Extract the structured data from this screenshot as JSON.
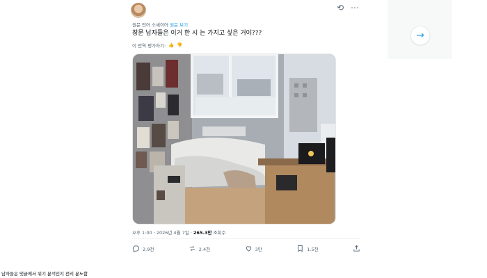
{
  "post": {
    "translated_prefix": "원문 언어 소세이어",
    "translated_link": "원문 보기",
    "text": "창문 남자들은 이거 한 시 는 가지고 싶은 거야???",
    "rate_label": "이 번역 평가하기:",
    "meta_time": "오후 1:00 · 2026년 4월 7일 · ",
    "meta_views_count": "265.3만",
    "meta_views_label": " 조회수",
    "actions": {
      "reply": "2.9천",
      "repost": "2.4천",
      "like": "3만",
      "bookmark": "1.5천"
    }
  },
  "caption": "남자들은 댓글에서 위기 분석인지 전리 분노함",
  "icons": [
    "avatar",
    "repost-icon",
    "more-icon",
    "thumbs-up-icon",
    "thumbs-down-icon",
    "reply-icon",
    "like-icon",
    "bookmark-icon",
    "share-icon",
    "arrow-right-icon"
  ]
}
